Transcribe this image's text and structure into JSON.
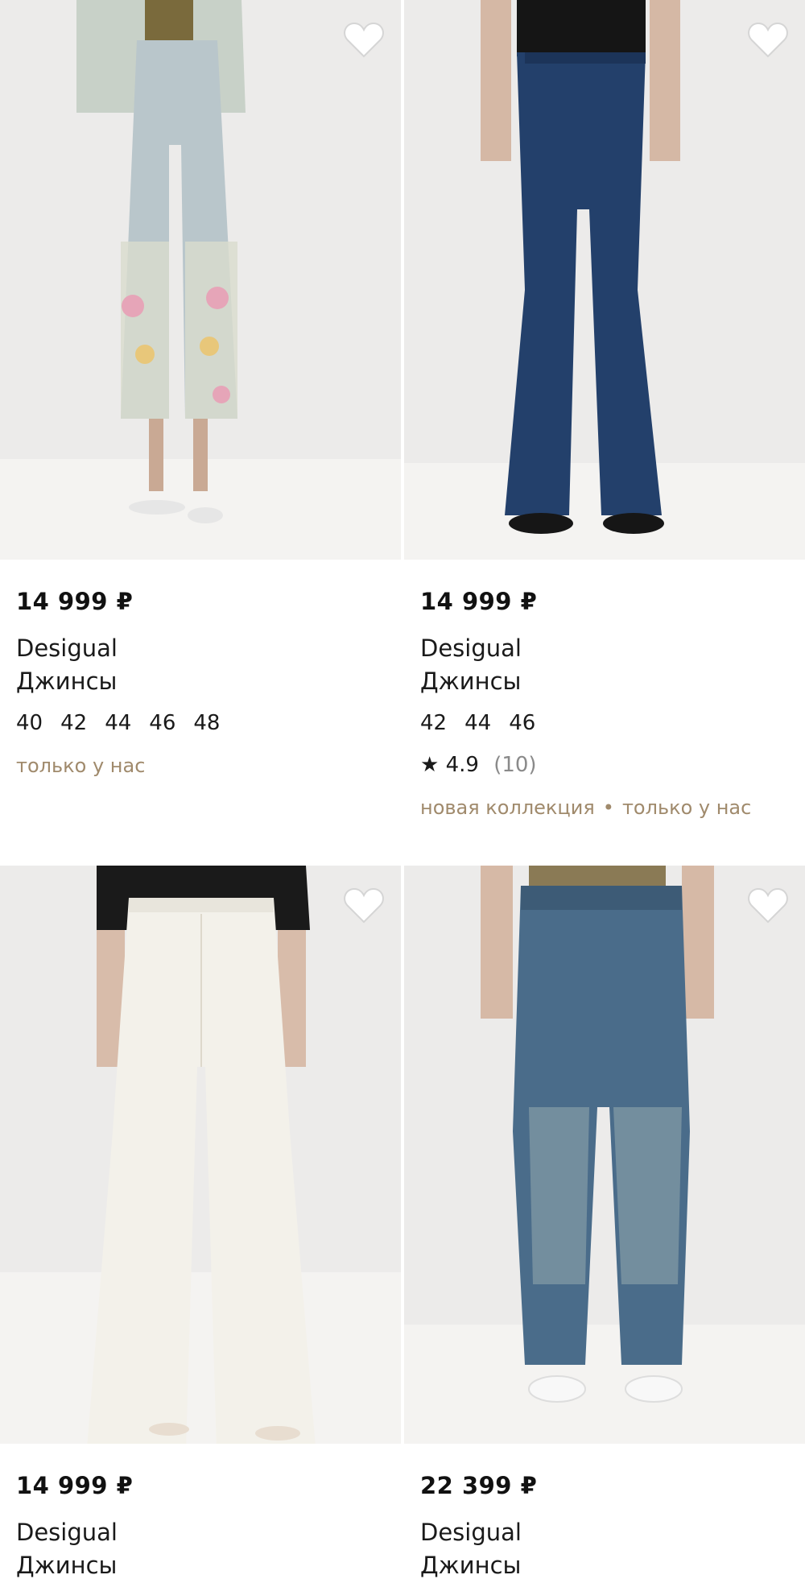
{
  "products": [
    {
      "price": "14 999 ₽",
      "brand": "Desigual",
      "type": "Джинсы",
      "sizes": [
        "40",
        "42",
        "44",
        "46",
        "48"
      ],
      "tags": [
        "только у нас"
      ],
      "image": "light-embroidered-cropped-flare-jeans",
      "colors": {
        "denim": "#b9c6cb",
        "bg": "#ecebea"
      }
    },
    {
      "price": "14 999 ₽",
      "brand": "Desigual",
      "type": "Джинсы",
      "sizes": [
        "42",
        "44",
        "46"
      ],
      "rating": {
        "star": "★",
        "value": "4.9",
        "count": "(10)"
      },
      "tags": [
        "новая коллекция",
        "только у нас"
      ],
      "image": "dark-blue-flare-jeans",
      "colors": {
        "denim": "#23406b",
        "bg": "#ecebea"
      }
    },
    {
      "price": "14 999 ₽",
      "brand": "Desigual",
      "type": "Джинсы",
      "image": "white-wide-leg-jeans",
      "colors": {
        "denim": "#f3f1ea",
        "bg": "#ecebea"
      }
    },
    {
      "price": "22 399 ₽",
      "brand": "Desigual",
      "type": "Джинсы",
      "image": "washed-blue-barrel-jeans",
      "colors": {
        "denim": "#4a6c8a",
        "bg": "#ecebea"
      }
    }
  ],
  "icons": {
    "favorite": "heart-outline-icon"
  },
  "colors": {
    "tag": "#a08a6c",
    "muted": "#8a8a8a"
  }
}
